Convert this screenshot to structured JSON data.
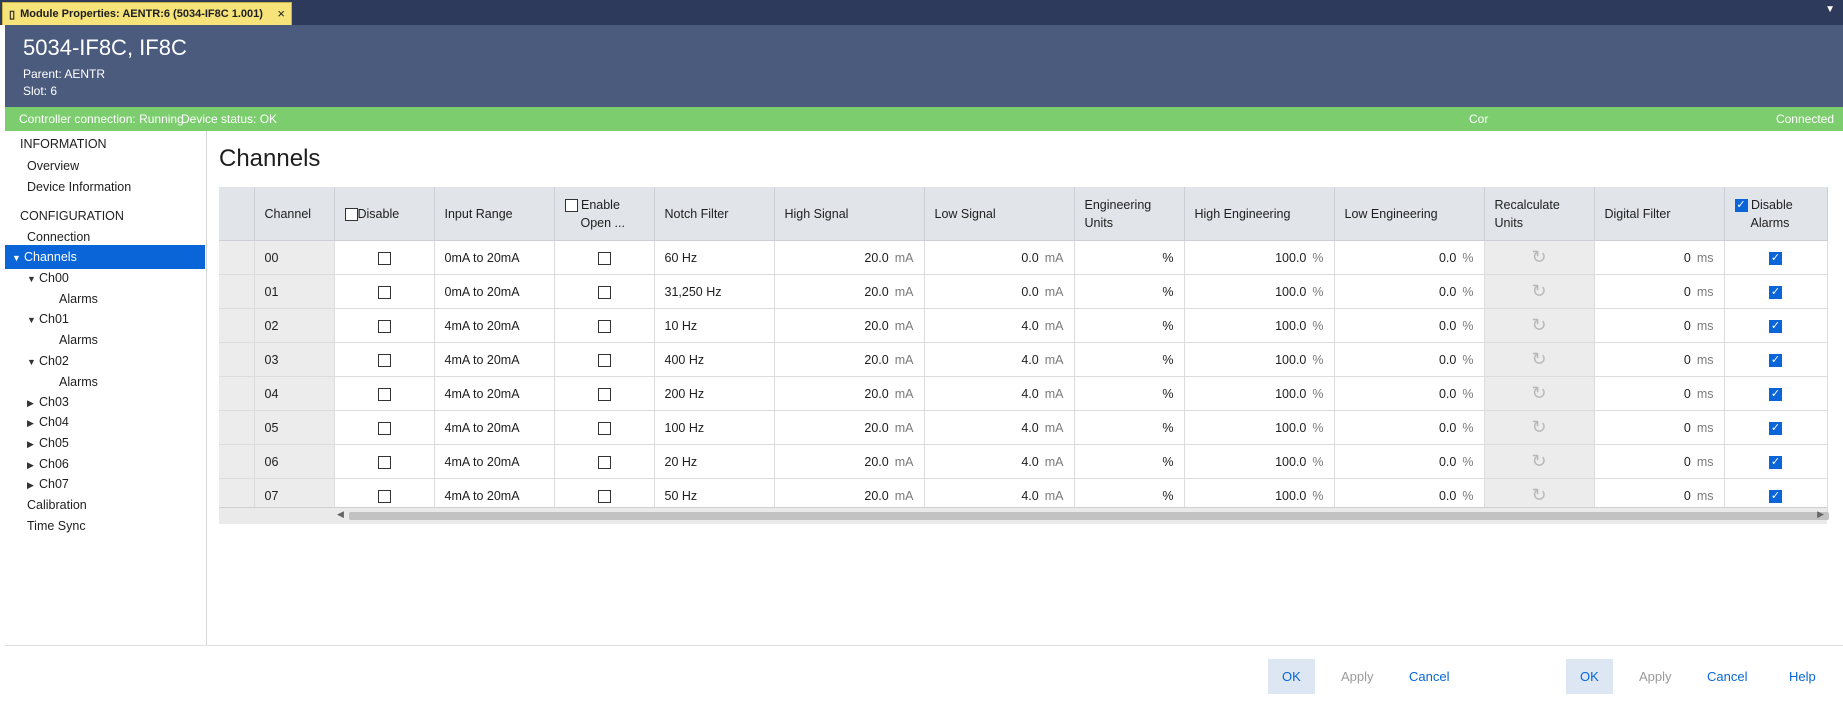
{
  "tab": {
    "title": "Module Properties:  AENTR:6 (5034-IF8C 1.001)",
    "close_glyph": "×"
  },
  "header": {
    "title": "5034-IF8C, IF8C",
    "parent": "Parent:  AENTR",
    "slot": "Slot:  6"
  },
  "status": {
    "controller": "Controller connection: Running",
    "device": "Device status: OK",
    "truncated": "Cor",
    "connected": "Connected"
  },
  "sidebar": {
    "information_heading": "INFORMATION",
    "overview": "Overview",
    "device_information": "Device Information",
    "configuration_heading": "CONFIGURATION",
    "connection": "Connection",
    "channels": "Channels",
    "ch00": "Ch00",
    "ch00_alarms": "Alarms",
    "ch01": "Ch01",
    "ch01_alarms": "Alarms",
    "ch02": "Ch02",
    "ch02_alarms": "Alarms",
    "ch03": "Ch03",
    "ch04": "Ch04",
    "ch05": "Ch05",
    "ch06": "Ch06",
    "ch07": "Ch07",
    "calibration": "Calibration",
    "time_sync": "Time Sync"
  },
  "main": {
    "title": "Channels",
    "columns": {
      "channel": "Channel",
      "disable": "Disable",
      "input_range": "Input Range",
      "enable_open_1": "Enable",
      "enable_open_2": "Open ...",
      "notch_filter": "Notch Filter",
      "high_signal": "High Signal",
      "low_signal": "Low Signal",
      "eng_units_1": "Engineering",
      "eng_units_2": "Units",
      "high_engineering": "High Engineering",
      "low_engineering": "Low Engineering",
      "recalc_1": "Recalculate",
      "recalc_2": "Units",
      "digital_filter": "Digital Filter",
      "disable_alarms_1": "Disable",
      "disable_alarms_2": "Alarms"
    },
    "units": {
      "signal": "mA",
      "percent": "%",
      "ms": "ms"
    },
    "rows": [
      {
        "channel": "00",
        "disable": false,
        "range": "0mA to 20mA",
        "open": false,
        "notch": "60 Hz",
        "high": "20.0",
        "low": "0.0",
        "eng": "%",
        "heng": "100.0",
        "leng": "0.0",
        "filter": "0",
        "alarms": true
      },
      {
        "channel": "01",
        "disable": false,
        "range": "0mA to 20mA",
        "open": false,
        "notch": "31,250 Hz",
        "high": "20.0",
        "low": "0.0",
        "eng": "%",
        "heng": "100.0",
        "leng": "0.0",
        "filter": "0",
        "alarms": true
      },
      {
        "channel": "02",
        "disable": false,
        "range": "4mA to 20mA",
        "open": false,
        "notch": "10 Hz",
        "high": "20.0",
        "low": "4.0",
        "eng": "%",
        "heng": "100.0",
        "leng": "0.0",
        "filter": "0",
        "alarms": true
      },
      {
        "channel": "03",
        "disable": false,
        "range": "4mA to 20mA",
        "open": false,
        "notch": "400 Hz",
        "high": "20.0",
        "low": "4.0",
        "eng": "%",
        "heng": "100.0",
        "leng": "0.0",
        "filter": "0",
        "alarms": true
      },
      {
        "channel": "04",
        "disable": false,
        "range": "4mA to 20mA",
        "open": false,
        "notch": "200 Hz",
        "high": "20.0",
        "low": "4.0",
        "eng": "%",
        "heng": "100.0",
        "leng": "0.0",
        "filter": "0",
        "alarms": true
      },
      {
        "channel": "05",
        "disable": false,
        "range": "4mA to 20mA",
        "open": false,
        "notch": "100 Hz",
        "high": "20.0",
        "low": "4.0",
        "eng": "%",
        "heng": "100.0",
        "leng": "0.0",
        "filter": "0",
        "alarms": true
      },
      {
        "channel": "06",
        "disable": false,
        "range": "4mA to 20mA",
        "open": false,
        "notch": "20 Hz",
        "high": "20.0",
        "low": "4.0",
        "eng": "%",
        "heng": "100.0",
        "leng": "0.0",
        "filter": "0",
        "alarms": true
      },
      {
        "channel": "07",
        "disable": false,
        "range": "4mA to 20mA",
        "open": false,
        "notch": "50 Hz",
        "high": "20.0",
        "low": "4.0",
        "eng": "%",
        "heng": "100.0",
        "leng": "0.0",
        "filter": "0",
        "alarms": true
      }
    ]
  },
  "footer": {
    "ok": "OK",
    "apply": "Apply",
    "cancel": "Cancel",
    "ok2": "OK",
    "apply2": "Apply",
    "cancel2": "Cancel",
    "help": "Help"
  },
  "icons": {
    "recalculate": "recalculate-icon",
    "checkbox_checked": "checkmark-icon",
    "expand": "expanded-arrow-icon",
    "collapsed": "collapsed-arrow-icon"
  },
  "colors": {
    "header_bg": "#4b5b7e",
    "status_bg": "#7ccd6e",
    "selection": "#0a66d8",
    "tab_bg": "#f6e37a"
  }
}
